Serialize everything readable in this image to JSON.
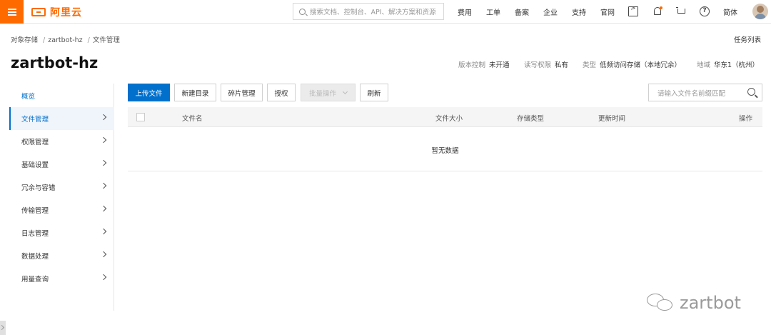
{
  "header": {
    "logo_text": "阿里云",
    "search_placeholder": "搜索文档、控制台、API、解决方案和资源",
    "nav": [
      "费用",
      "工单",
      "备案",
      "企业",
      "支持",
      "官网"
    ],
    "lang": "简体",
    "icons": [
      "menu-icon",
      "terminal-icon",
      "bell-icon",
      "cart-icon",
      "help-icon"
    ],
    "accent_color": "#ff6a00"
  },
  "breadcrumb": [
    "对象存储",
    "zartbot-hz",
    "文件管理"
  ],
  "task_list": "任务列表",
  "bucket": {
    "title": "zartbot-hz",
    "meta": [
      {
        "key": "版本控制",
        "value": "未开通"
      },
      {
        "key": "读写权限",
        "value": "私有"
      },
      {
        "key": "类型",
        "value": "低频访问存储（本地冗余）"
      },
      {
        "key": "地域",
        "value": "华东1（杭州）"
      }
    ]
  },
  "sidebar": {
    "items": [
      {
        "label": "概览"
      },
      {
        "label": "文件管理"
      },
      {
        "label": "权限管理"
      },
      {
        "label": "基础设置"
      },
      {
        "label": "冗余与容错"
      },
      {
        "label": "传输管理"
      },
      {
        "label": "日志管理"
      },
      {
        "label": "数据处理"
      },
      {
        "label": "用量查询"
      }
    ]
  },
  "toolbar": {
    "upload": "上传文件",
    "new_dir": "新建目录",
    "fragments": "碎片管理",
    "authorize": "授权",
    "batch": "批量操作",
    "refresh": "刷新",
    "search_placeholder": "请输入文件名前缀匹配"
  },
  "table": {
    "columns": [
      "文件名",
      "文件大小",
      "存储类型",
      "更新时间",
      "操作"
    ],
    "empty_text": "暂无数据"
  },
  "watermark": "zartbot",
  "primary_color": "#0070cc"
}
